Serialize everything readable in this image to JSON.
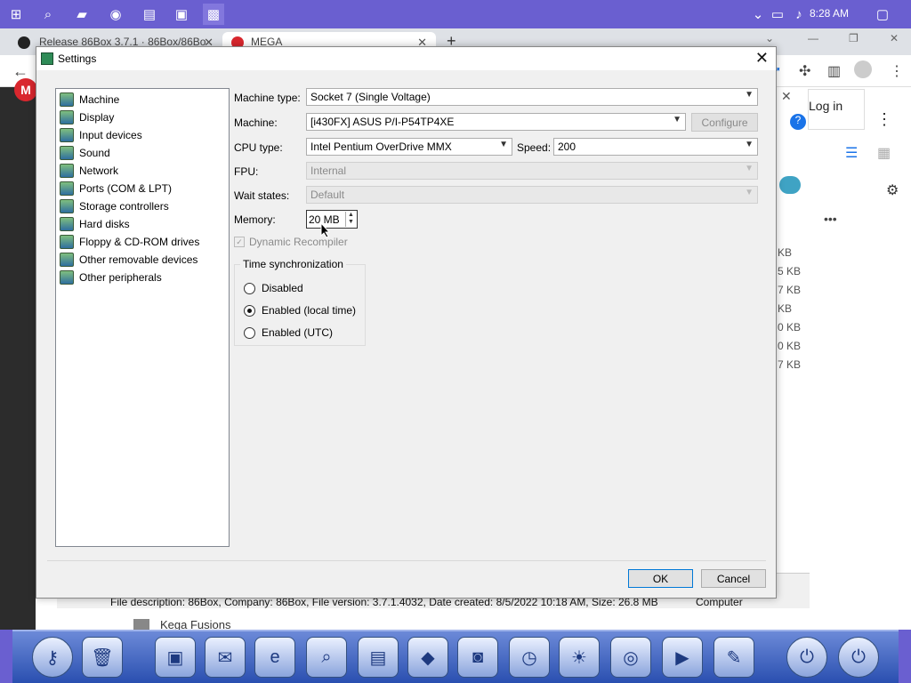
{
  "taskbar": {
    "time": "8:28 AM",
    "icons": [
      "windows-icon",
      "search-icon",
      "file-explorer-icon",
      "chrome-icon",
      "notepad-icon",
      "7zip-icon",
      "86box-icon"
    ]
  },
  "browser": {
    "tabs": [
      {
        "label": "Release 86Box 3.7.1 · 86Box/86Bo"
      },
      {
        "label": "MEGA"
      }
    ],
    "new_tab": "+",
    "login_label": "Log in",
    "mega_logo": "M",
    "sizes": [
      "KB",
      "5 KB",
      "7 KB",
      "KB",
      "0 KB",
      "0 KB",
      "7 KB"
    ],
    "file_description": "File description: 86Box, Company: 86Box, File version: 3.7.1.4032, Date created: 8/5/2022 10:18 AM, Size: 26.8 MB",
    "computer_label": "Computer",
    "folder_label": "Kega Fusions"
  },
  "dialog": {
    "title": "Settings",
    "nav_items": [
      "Machine",
      "Display",
      "Input devices",
      "Sound",
      "Network",
      "Ports (COM & LPT)",
      "Storage controllers",
      "Hard disks",
      "Floppy & CD-ROM drives",
      "Other removable devices",
      "Other peripherals"
    ],
    "labels": {
      "machine_type": "Machine type:",
      "machine": "Machine:",
      "cpu_type": "CPU type:",
      "speed": "Speed:",
      "fpu": "FPU:",
      "wait_states": "Wait states:",
      "memory": "Memory:"
    },
    "values": {
      "machine_type": "Socket 7 (Single Voltage)",
      "machine": "[i430FX] ASUS P/I-P54TP4XE",
      "cpu_type": "Intel Pentium OverDrive MMX",
      "speed": "200",
      "fpu": "Internal",
      "wait_states": "Default",
      "memory": "20 MB"
    },
    "configure_label": "Configure",
    "dynamic_recompiler": "Dynamic Recompiler",
    "time_sync": {
      "title": "Time synchronization",
      "options": [
        "Disabled",
        "Enabled (local time)",
        "Enabled (UTC)"
      ],
      "selected": 1
    },
    "ok_label": "OK",
    "cancel_label": "Cancel"
  }
}
